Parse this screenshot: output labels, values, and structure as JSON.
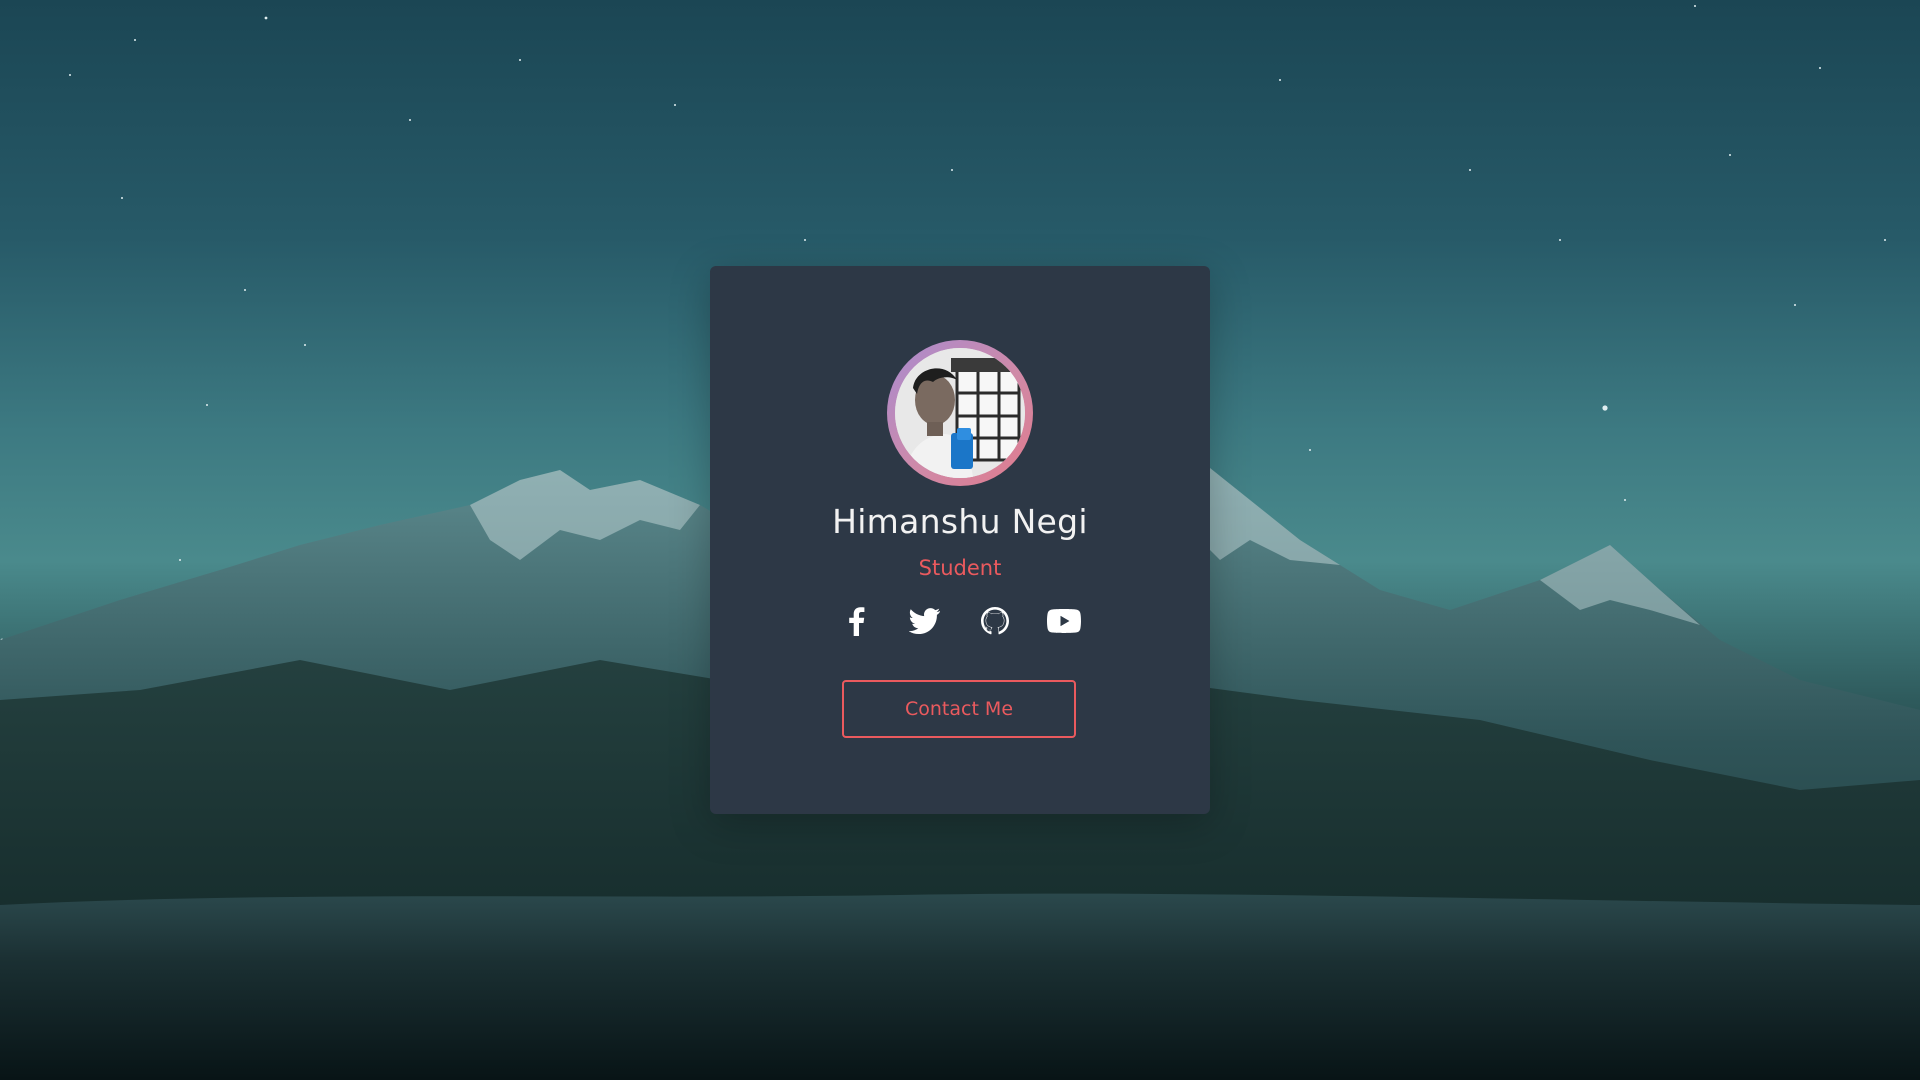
{
  "profile": {
    "name": "Himanshu Negi",
    "role": "Student"
  },
  "socials": [
    {
      "icon": "facebook-icon"
    },
    {
      "icon": "twitter-icon"
    },
    {
      "icon": "github-icon"
    },
    {
      "icon": "youtube-icon"
    }
  ],
  "contact_button": {
    "label": "Contact Me"
  },
  "colors": {
    "card": "#2d3846",
    "accent": "#ea5a5e",
    "name_text": "#f2f2f2",
    "avatar_ring_start": "#a88bd0",
    "avatar_ring_end": "#e07a8c"
  }
}
